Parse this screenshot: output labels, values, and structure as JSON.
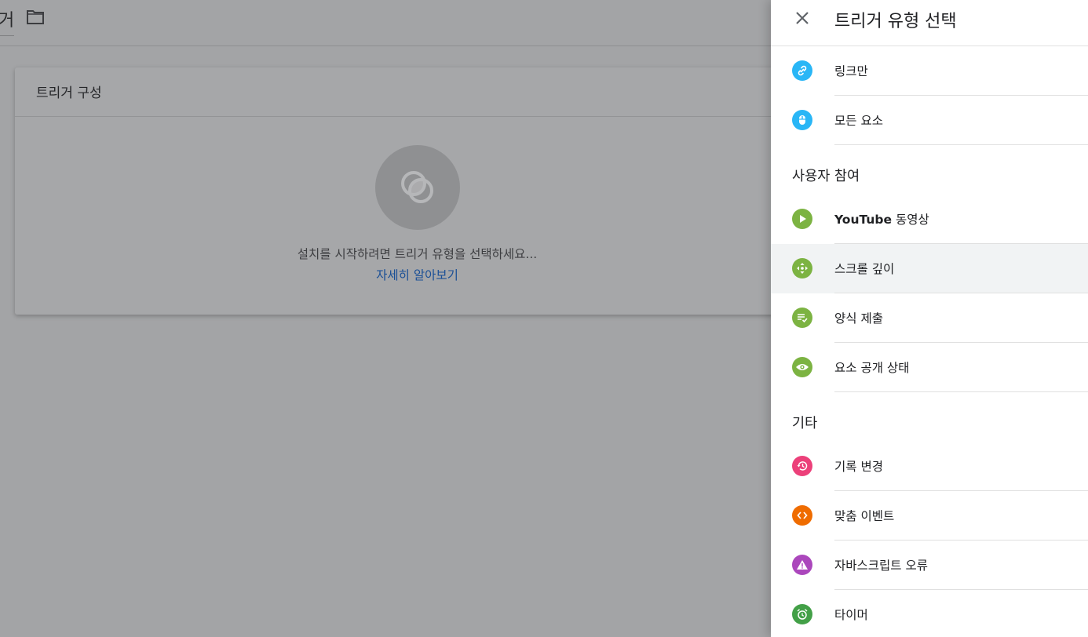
{
  "background": {
    "page_title": "거",
    "card_title": "트리거 구성",
    "hint": "설치를 시작하려면 트리거 유형을 선택하세요...",
    "learn_more": "자세히 알아보기"
  },
  "panel": {
    "title": "트리거 유형 선택",
    "items_top": [
      {
        "label": "링크만",
        "icon": "link-icon"
      },
      {
        "label": "모든 요소",
        "icon": "mouse-icon"
      }
    ],
    "section_engagement": "사용자 참여",
    "engagement": [
      {
        "label_bold": "YouTube",
        "label": "동영상",
        "icon": "play-icon"
      },
      {
        "label": "스크롤 깊이",
        "icon": "scroll-icon"
      },
      {
        "label": "양식 제출",
        "icon": "form-icon"
      },
      {
        "label": "요소 공개 상태",
        "icon": "eye-icon"
      }
    ],
    "section_other": "기타",
    "other": [
      {
        "label": "기록 변경",
        "icon": "history-icon"
      },
      {
        "label": "맞춤 이벤트",
        "icon": "code-icon"
      },
      {
        "label": "자바스크립트 오류",
        "icon": "warning-icon"
      },
      {
        "label": "타이머",
        "icon": "alarm-icon"
      }
    ]
  },
  "colors": {
    "click": "#29b6f6",
    "engagement": "#7cb342",
    "history": "#ec407a",
    "custom_event": "#ef6c00",
    "js_error": "#ab47bc",
    "timer": "#43a047"
  }
}
